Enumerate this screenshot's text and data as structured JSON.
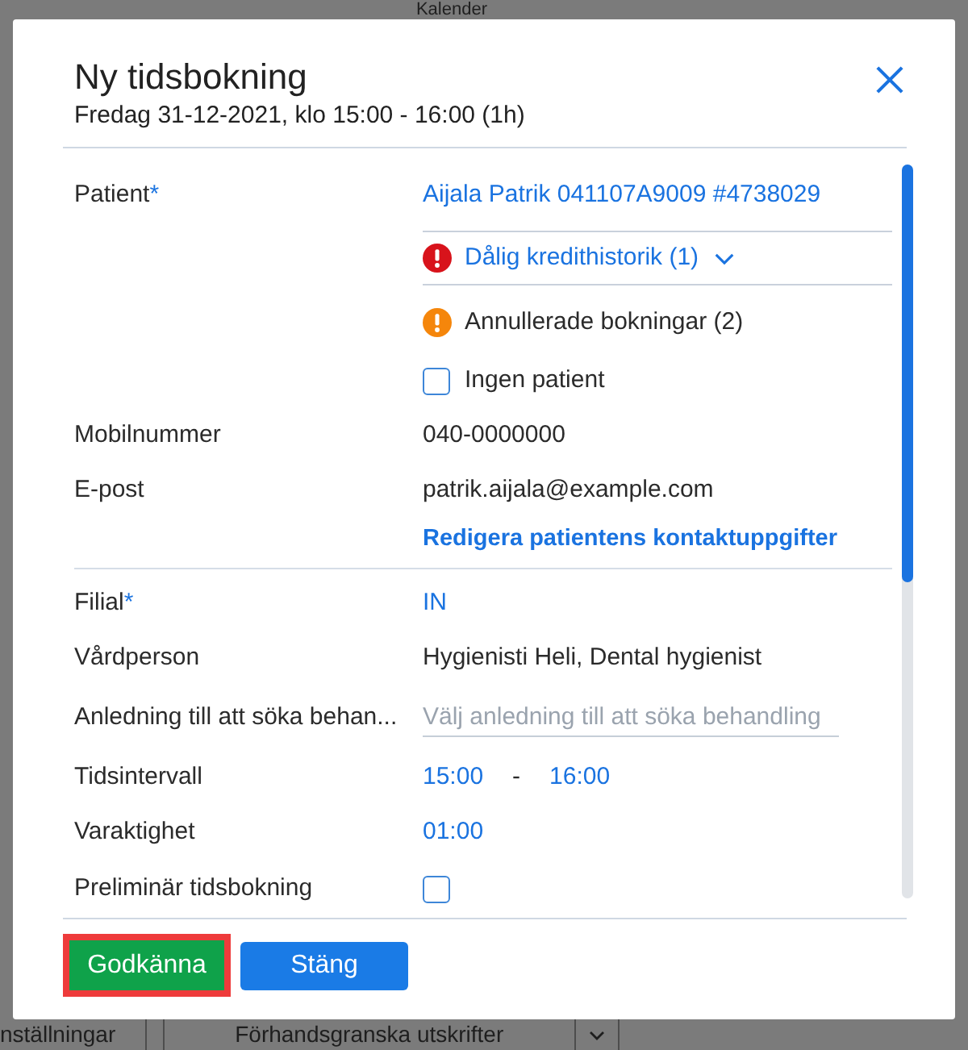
{
  "background": {
    "title": "Kalender",
    "toolbar": [
      {
        "kind": "button",
        "label": "nställningar"
      },
      {
        "kind": "select",
        "label": "Förhandsgranska utskrifter"
      }
    ]
  },
  "dialog": {
    "title": "Ny tidsbokning",
    "subtitle": "Fredag 31-12-2021, klo 15:00 - 16:00 (1h)",
    "sections": [
      {
        "fields": [
          {
            "kind": "patient",
            "label": "Patient",
            "mark": "*",
            "value": "Aijala Patrik 041107A9009 #4738029",
            "alerts": [
              {
                "kind": "expandable",
                "color": "#d8131b",
                "text": "Dålig kredithistorik (1)",
                "expanded": false
              },
              {
                "kind": "plain",
                "color": "#f5860b",
                "text": "Annullerade bokningar (2)"
              }
            ],
            "no_patient": {
              "label": "Ingen patient",
              "checked": false
            }
          },
          {
            "kind": "text",
            "label": "Mobilnummer",
            "value": "040-0000000"
          },
          {
            "kind": "text",
            "label": "E-post",
            "value": "patrik.aijala@example.com"
          },
          {
            "kind": "action",
            "value": "Redigera patientens kontaktuppgifter"
          }
        ]
      },
      {
        "fields": [
          {
            "kind": "link",
            "label": "Filial",
            "mark": "*",
            "value": "IN"
          },
          {
            "kind": "text",
            "label": "Vårdperson",
            "value": "Hygienisti Heli, Dental hygienist"
          },
          {
            "kind": "select",
            "label": "Anledning till att söka behan...",
            "placeholder": "Välj anledning till att söka behandling"
          },
          {
            "kind": "range",
            "label": "Tidsintervall",
            "start": "15:00",
            "separator": "-",
            "end": "16:00"
          },
          {
            "kind": "link",
            "label": "Varaktighet",
            "value": "01:00"
          },
          {
            "kind": "checkbox",
            "label": "Preliminär tidsbokning",
            "checked": false
          }
        ]
      }
    ],
    "buttons": [
      {
        "kind": "primary",
        "label": "Godkänna",
        "highlighted": true
      },
      {
        "kind": "secondary",
        "label": "Stäng",
        "highlighted": false
      }
    ]
  }
}
